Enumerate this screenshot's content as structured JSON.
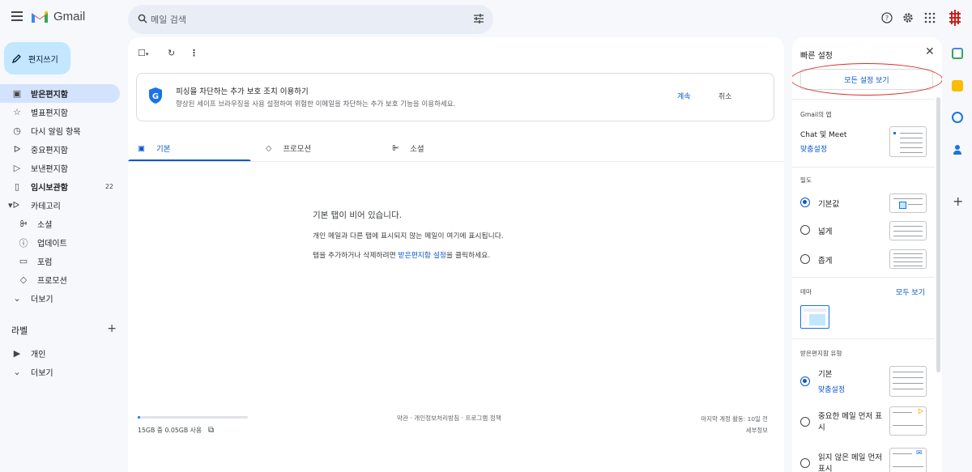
{
  "app": {
    "name": "Gmail"
  },
  "search": {
    "placeholder": "메일 검색"
  },
  "compose": {
    "label": "편지쓰기"
  },
  "sidebar": {
    "items": [
      {
        "label": "받은편지함",
        "icon": "inbox-icon"
      },
      {
        "label": "별표편지함",
        "icon": "star-icon"
      },
      {
        "label": "다시 알림 항목",
        "icon": "clock-icon"
      },
      {
        "label": "중요편지함",
        "icon": "important-icon"
      },
      {
        "label": "보낸편지함",
        "icon": "send-icon"
      },
      {
        "label": "임시보관함",
        "icon": "draft-icon",
        "count": "22"
      },
      {
        "label": "카테고리",
        "icon": "category-icon"
      },
      {
        "label": "소셜",
        "icon": "people-icon"
      },
      {
        "label": "업데이트",
        "icon": "info-icon"
      },
      {
        "label": "포럼",
        "icon": "forum-icon"
      },
      {
        "label": "프로모션",
        "icon": "tag-icon"
      },
      {
        "label": "더보기",
        "icon": "chevron-down-icon"
      }
    ],
    "labels_title": "라벨",
    "labels": [
      {
        "label": "개인",
        "icon": "label-icon"
      },
      {
        "label": "더보기",
        "icon": "chevron-down-icon"
      }
    ]
  },
  "notice": {
    "title": "피싱을 차단하는 추가 보호 조치 이용하기",
    "subtitle": "향상된 세이프 브라우징을 사용 설정하여 위험한 이메일을 차단하는 추가 보호 기능을 이용하세요.",
    "continue": "계속",
    "cancel": "취소"
  },
  "tabs": [
    {
      "label": "기본",
      "icon": "inbox-icon",
      "active": true
    },
    {
      "label": "프로모션",
      "icon": "tag-icon"
    },
    {
      "label": "소셜",
      "icon": "people-icon"
    }
  ],
  "empty": {
    "title": "기본 탭이 비어 있습니다.",
    "line1": "개인 메일과 다른 탭에 표시되지 않는 메일이 여기에 표시됩니다.",
    "line2_pre": "탭을 추가하거나 삭제하려면 ",
    "line2_link": "받은편지함 설정",
    "line2_post": "을 클릭하세요."
  },
  "footer": {
    "storage": "15GB 중 0.05GB 사용",
    "storage_used_fraction": 0.003,
    "links": "약관 · 개인정보처리방침 · 프로그램 정책",
    "last_activity": "마지막 계정 활동: 10일 전",
    "details": "세부정보"
  },
  "quick_settings": {
    "title": "빠른 설정",
    "all_settings": "모든 설정 보기",
    "apps_title": "Gmail의 앱",
    "chat_meet": "Chat 및 Meet",
    "customize": "맞춤설정",
    "density_title": "밀도",
    "density_options": [
      "기본값",
      "넓게",
      "좁게"
    ],
    "theme_title": "테마",
    "theme_all": "모두 보기",
    "inbox_type_title": "받은편지함 유형",
    "inbox_types": [
      "기본",
      "중요한 메일 먼저 표시",
      "읽지 않은 메일 먼저 표시"
    ],
    "inbox_customize": "맞춤설정"
  },
  "colors": {
    "accent": "#0b57d0",
    "compose_bg": "#c2e7ff",
    "active_nav": "#d3e3fd",
    "highlight": "#d93025"
  }
}
